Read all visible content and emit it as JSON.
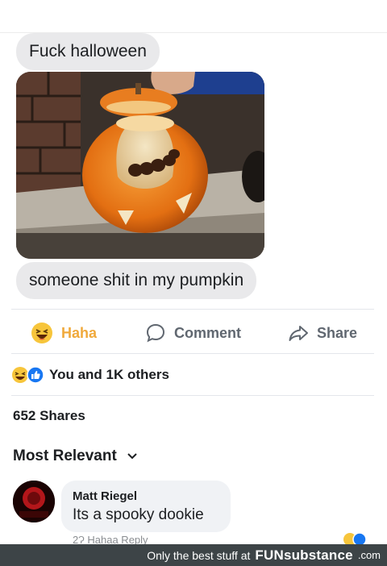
{
  "messages": {
    "first": "Fuck halloween",
    "second": "someone shit in my pumpkin"
  },
  "photo": {
    "icon": "carved-pumpkin-photo"
  },
  "actions": {
    "haha": "Haha",
    "comment": "Comment",
    "share": "Share"
  },
  "reactions": {
    "summary": "You and 1K others",
    "icons": [
      "haha-emoji",
      "like-thumb"
    ]
  },
  "shares": "652 Shares",
  "sort": {
    "label": "Most Relevant",
    "icon": "chevron-down-icon"
  },
  "comment": {
    "author": "Matt Riegel",
    "text": "Its a spooky dookie",
    "meta_partial": "2Ɂ      Hahaa    Reply"
  },
  "footer": {
    "tagline": "Only the best stuff at",
    "brand_a": "FUN",
    "brand_b": "substance",
    "domain": ".com"
  },
  "colors": {
    "haha": "#f0a93b",
    "like": "#1877f2",
    "bubble": "#e9e9eb",
    "pumpkin": "#e8741c"
  }
}
